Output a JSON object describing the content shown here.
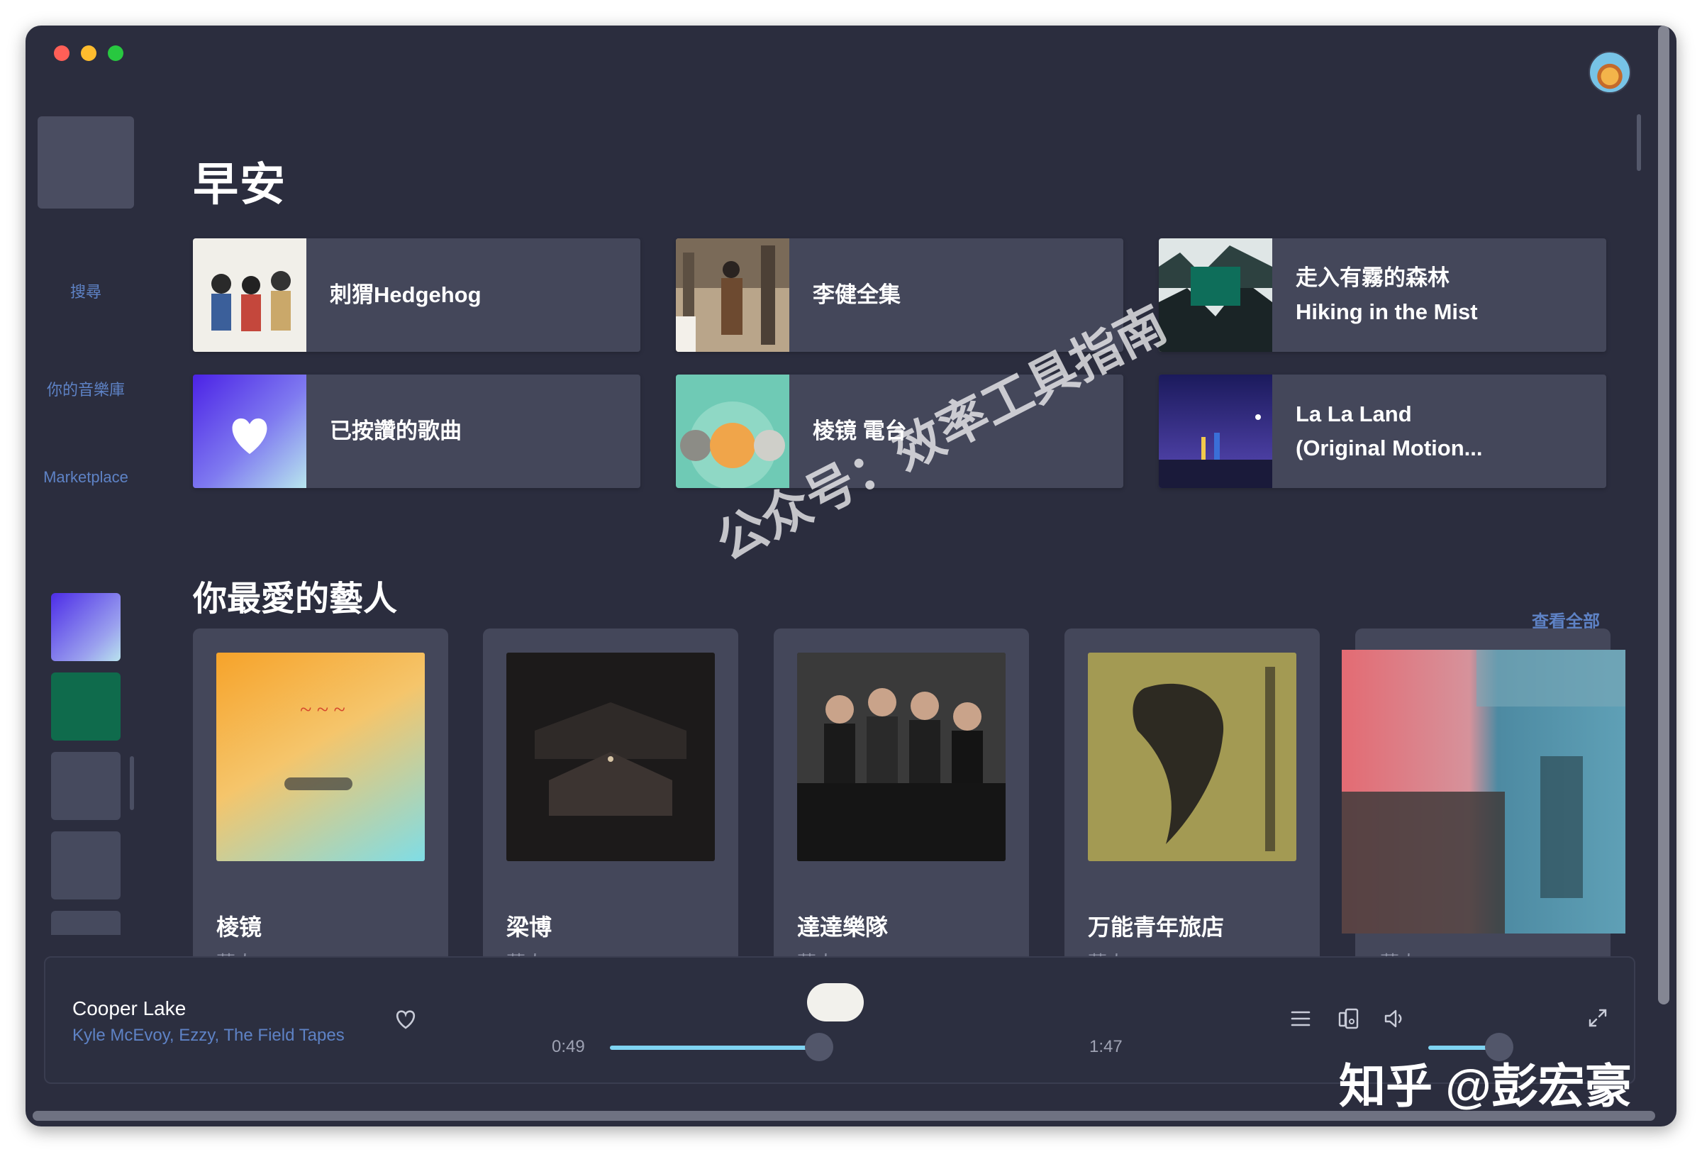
{
  "sidebar": {
    "links": [
      "搜尋",
      "你的音樂庫",
      "Marketplace"
    ]
  },
  "main": {
    "greeting": "早安",
    "quick_items": [
      {
        "title": "刺猬Hedgehog"
      },
      {
        "title": "李健全集"
      },
      {
        "title": "走入有霧的森林\nHiking in the Mist"
      },
      {
        "title": "已按讚的歌曲"
      },
      {
        "title": "棱镜 電台"
      },
      {
        "title": "La La Land\n(Original Motion..."
      }
    ],
    "artists_section": {
      "title": "你最愛的藝人",
      "see_all": "查看全部",
      "artists": [
        {
          "name": "棱镜",
          "subtitle": "藝人"
        },
        {
          "name": "梁博",
          "subtitle": "藝人"
        },
        {
          "name": "達達樂隊",
          "subtitle": "藝人"
        },
        {
          "name": "万能青年旅店",
          "subtitle": "藝人"
        },
        {
          "name": "",
          "subtitle": "藝人"
        }
      ]
    }
  },
  "player": {
    "track_title": "Cooper Lake",
    "artists": "Kyle McEvoy, Ezzy, The Field Tapes",
    "elapsed": "0:49",
    "duration": "1:47",
    "progress": 0.457,
    "volume": 0.75
  },
  "overlays": {
    "watermark": "公众号：效率工具指南",
    "zhihu": "知乎 @彭宏豪"
  },
  "colors": {
    "background": "#2b2d3e",
    "card": "#44475a",
    "accent_link": "#5e82c5",
    "progress": "#7fd4f2"
  }
}
